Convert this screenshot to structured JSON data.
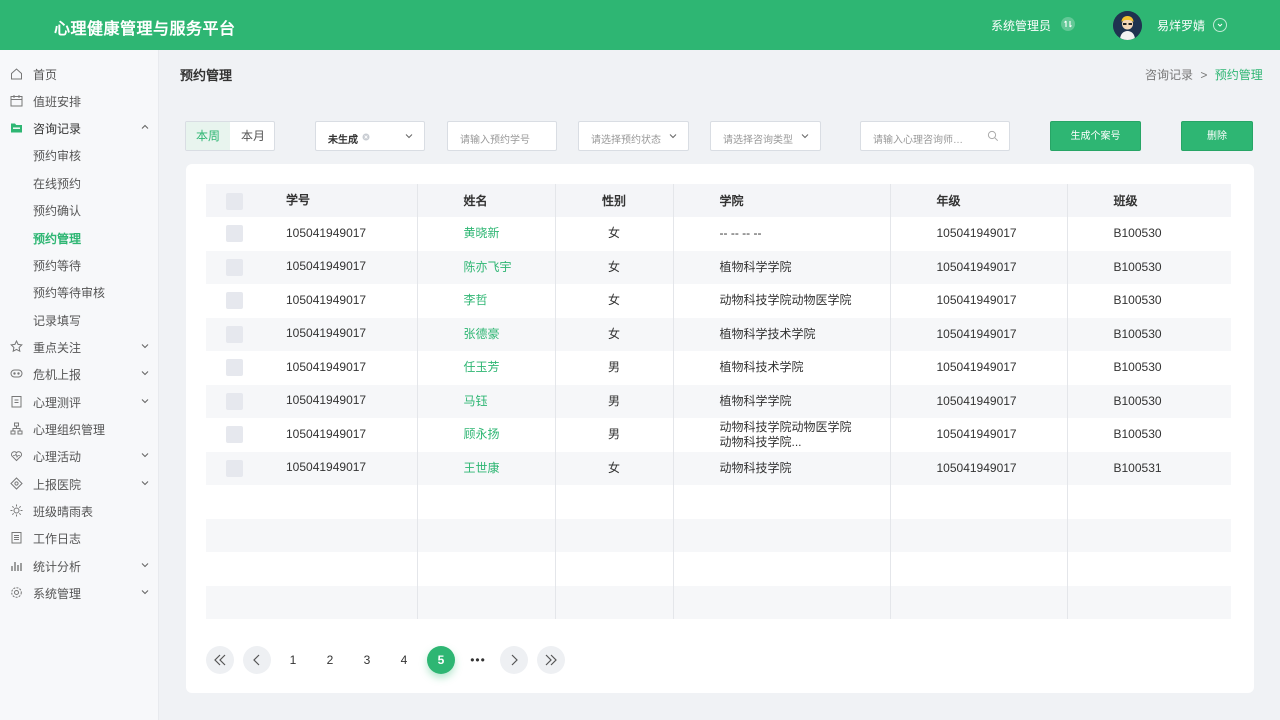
{
  "header": {
    "app_title": "心理健康管理与服务平台",
    "role": "系统管理员",
    "username": "易烊罗婧"
  },
  "colors": {
    "brand": "#2eb673"
  },
  "sidebar": {
    "items": [
      {
        "label": "首页",
        "icon": "home-icon"
      },
      {
        "label": "值班安排",
        "icon": "calendar-icon"
      },
      {
        "label": "咨询记录",
        "icon": "folder-icon",
        "expanded": true
      },
      {
        "label": "预约审核",
        "sub": true
      },
      {
        "label": "在线预约",
        "sub": true
      },
      {
        "label": "预约确认",
        "sub": true
      },
      {
        "label": "预约管理",
        "sub": true,
        "active": true
      },
      {
        "label": "预约等待",
        "sub": true
      },
      {
        "label": "预约等待审核",
        "sub": true
      },
      {
        "label": "记录填写",
        "sub": true
      },
      {
        "label": "重点关注",
        "icon": "star-icon",
        "caret": true
      },
      {
        "label": "危机上报",
        "icon": "alert-icon",
        "caret": true
      },
      {
        "label": "心理测评",
        "icon": "clipboard-icon",
        "caret": true
      },
      {
        "label": "心理组织管理",
        "icon": "org-icon"
      },
      {
        "label": "心理活动",
        "icon": "heart-icon",
        "caret": true
      },
      {
        "label": "上报医院",
        "icon": "hospital-icon",
        "caret": true
      },
      {
        "label": "班级晴雨表",
        "icon": "sun-icon"
      },
      {
        "label": "工作日志",
        "icon": "log-icon"
      },
      {
        "label": "统计分析",
        "icon": "bar-chart-icon",
        "caret": true
      },
      {
        "label": "系统管理",
        "icon": "gear-icon",
        "caret": true
      }
    ]
  },
  "page": {
    "title": "预约管理",
    "breadcrumb_parent": "咨询记录",
    "breadcrumb_sep": ">",
    "breadcrumb_current": "预约管理"
  },
  "filters": {
    "week": "本周",
    "month": "本月",
    "status_value": "未生成",
    "student_id_placeholder": "请输入预约学号",
    "booking_status_placeholder": "请选择预约状态",
    "consult_type_placeholder": "请选择咨询类型",
    "counselor_placeholder": "请输入心理咨询师…",
    "generate_label": "生成个案号",
    "delete_label": "删除"
  },
  "table": {
    "headers": [
      "学号",
      "姓名",
      "性别",
      "学院",
      "年级",
      "班级"
    ],
    "rows": [
      {
        "id": "105041949017",
        "name": "黄晓新",
        "gender": "女",
        "college": "-- -- -- --",
        "grade": "105041949017",
        "class": "B100530"
      },
      {
        "id": "105041949017",
        "name": "陈亦飞宇",
        "gender": "女",
        "college": "植物科学学院",
        "grade": "105041949017",
        "class": "B100530"
      },
      {
        "id": "105041949017",
        "name": "李哲",
        "gender": "女",
        "college": "动物科技学院动物医学院",
        "grade": "105041949017",
        "class": "B100530"
      },
      {
        "id": "105041949017",
        "name": "张德豪",
        "gender": "女",
        "college": "植物科学技术学院",
        "grade": "105041949017",
        "class": "B100530"
      },
      {
        "id": "105041949017",
        "name": "任玉芳",
        "gender": "男",
        "college": "植物科技术学院",
        "grade": "105041949017",
        "class": "B100530"
      },
      {
        "id": "105041949017",
        "name": "马钰",
        "gender": "男",
        "college": "植物科学学院",
        "grade": "105041949017",
        "class": "B100530"
      },
      {
        "id": "105041949017",
        "name": "顾永扬",
        "gender": "男",
        "college": "动物科技学院动物医学院",
        "college2": "动物科技学院...",
        "grade": "105041949017",
        "class": "B100530"
      },
      {
        "id": "105041949017",
        "name": "王世康",
        "gender": "女",
        "college": "动物科技学院",
        "grade": "105041949017",
        "class": "B100531"
      }
    ]
  },
  "pagination": {
    "pages": [
      "1",
      "2",
      "3",
      "4",
      "5"
    ],
    "current": "5",
    "ellipsis": "•••"
  }
}
